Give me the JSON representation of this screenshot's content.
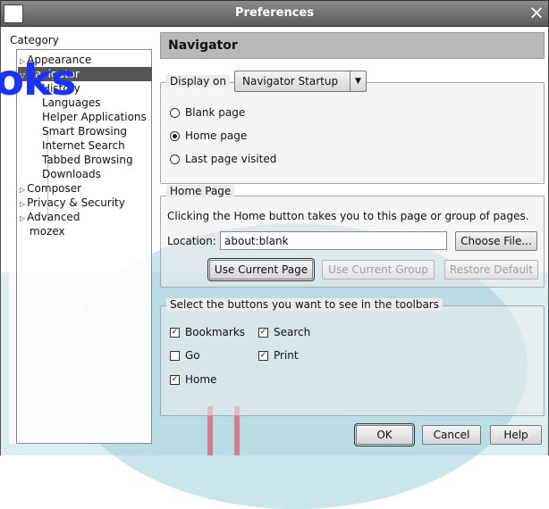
{
  "window": {
    "title": "Preferences"
  },
  "sidebar": {
    "category_label": "Category",
    "watermark": "oks",
    "items": [
      {
        "label": "Appearance",
        "arrow": "▷"
      },
      {
        "label": "Navigator",
        "arrow": "▽"
      },
      {
        "label": "History"
      },
      {
        "label": "Languages"
      },
      {
        "label": "Helper Applications"
      },
      {
        "label": "Smart Browsing"
      },
      {
        "label": "Internet Search"
      },
      {
        "label": "Tabbed Browsing"
      },
      {
        "label": "Downloads"
      },
      {
        "label": "Composer",
        "arrow": "▷"
      },
      {
        "label": "Privacy & Security",
        "arrow": "▷"
      },
      {
        "label": "Advanced",
        "arrow": "▷"
      },
      {
        "label": "mozex"
      }
    ]
  },
  "main": {
    "header": "Navigator",
    "display_on": {
      "label": "Display on",
      "selected": "Navigator Startup",
      "options": [
        "Blank page",
        "Home page",
        "Last page visited"
      ],
      "checked_index": 1
    },
    "home_page": {
      "legend": "Home Page",
      "description": "Clicking the Home button takes you to this page or group of pages.",
      "location_label": "Location:",
      "location_value": "about:blank",
      "choose_file": "Choose File...",
      "use_current_page": "Use Current Page",
      "use_current_group": "Use Current Group",
      "restore_default": "Restore Default"
    },
    "toolbar_buttons": {
      "legend": "Select the buttons you want to see in the toolbars",
      "items": [
        {
          "label": "Bookmarks",
          "checked": true
        },
        {
          "label": "Search",
          "checked": true
        },
        {
          "label": "Go",
          "checked": false
        },
        {
          "label": "Print",
          "checked": true
        },
        {
          "label": "Home",
          "checked": true
        }
      ]
    }
  },
  "footer": {
    "ok": "OK",
    "cancel": "Cancel",
    "help": "Help"
  },
  "icons": {
    "close": "×",
    "check": "✓"
  }
}
